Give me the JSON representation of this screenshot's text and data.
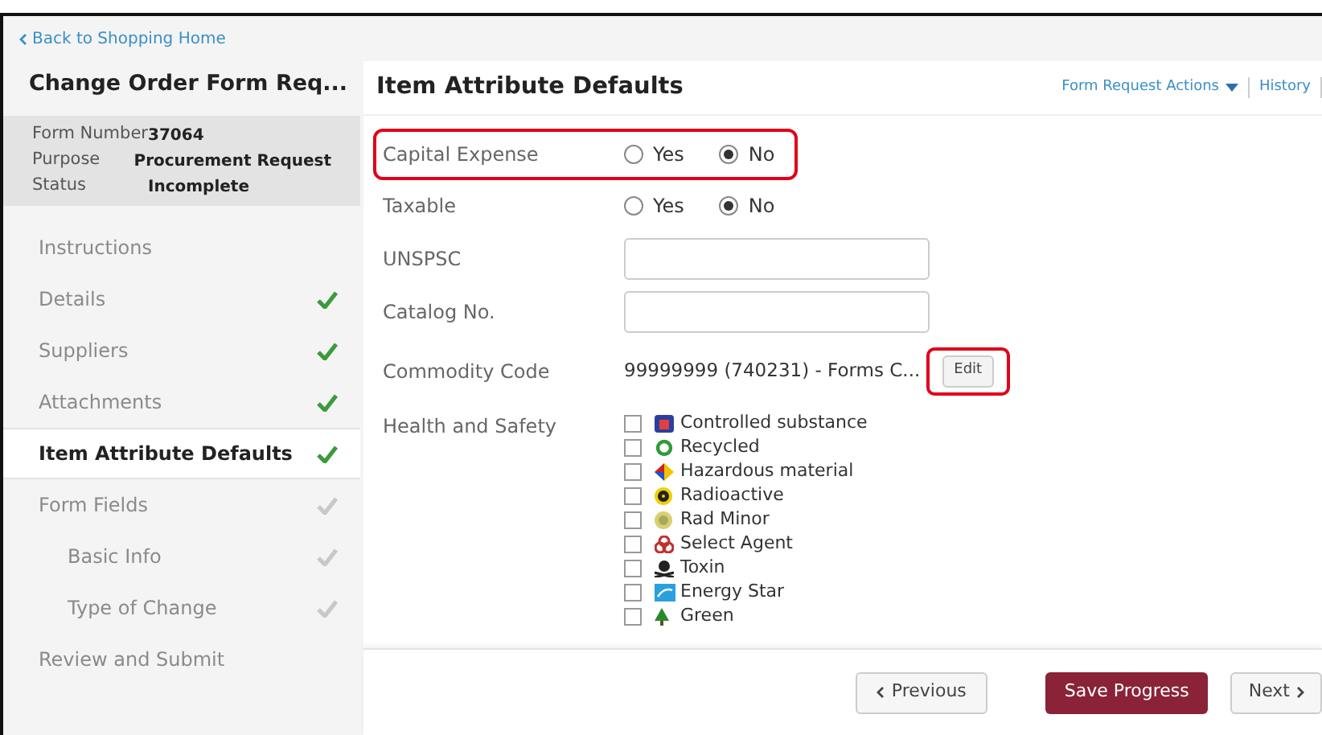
{
  "back_link": "Back to Shopping Home",
  "form_title": "Change Order Form Req...",
  "info": [
    {
      "label": "Form Number",
      "value": "37064"
    },
    {
      "label": "Purpose",
      "value": "Procurement Request"
    },
    {
      "label": "Status",
      "value": "Incomplete"
    }
  ],
  "nav": [
    {
      "label": "Instructions",
      "selected": false
    },
    {
      "label": "Details",
      "selected": false,
      "complete": true
    },
    {
      "label": "Suppliers",
      "selected": false,
      "complete": true
    },
    {
      "label": "Attachments",
      "selected": false,
      "complete": true
    },
    {
      "label": "Item Attribute Defaults",
      "selected": true,
      "complete": true
    },
    {
      "label": "Form Fields",
      "selected": false,
      "complete": false,
      "children": [
        {
          "label": "Basic Info",
          "selected": false,
          "complete": false
        },
        {
          "label": "Type of Change",
          "selected": false,
          "complete": false
        }
      ]
    },
    {
      "label": "Review and Submit",
      "selected": false
    }
  ],
  "page_title": "Item Attribute Defaults",
  "actions": [
    {
      "label": "Form Request Actions",
      "kind": "dropdown"
    },
    {
      "label": "History",
      "kind": "link"
    }
  ],
  "fields": [
    {
      "kind": "radio",
      "label": "Capital Expense",
      "highlighted": true,
      "options": [
        {
          "label": "Yes",
          "selected": false
        },
        {
          "label": "No",
          "selected": true
        }
      ]
    },
    {
      "kind": "radio",
      "label": "Taxable",
      "highlighted": false,
      "options": [
        {
          "label": "Yes",
          "selected": false
        },
        {
          "label": "No",
          "selected": true
        }
      ]
    },
    {
      "kind": "text",
      "label": "UNSPSC"
    },
    {
      "kind": "text",
      "label": "Catalog No."
    },
    {
      "kind": "code",
      "label": "Commodity Code",
      "value": "99999999 (740231) - Forms C...",
      "button": "Edit",
      "button_highlighted": true
    },
    {
      "kind": "checklist",
      "label": "Health and Safety",
      "items": [
        {
          "label": "Controlled substance",
          "checked": false
        },
        {
          "label": "Recycled",
          "checked": false
        },
        {
          "label": "Hazardous material",
          "checked": false
        },
        {
          "label": "Radioactive",
          "checked": false
        },
        {
          "label": "Rad Minor",
          "checked": false
        },
        {
          "label": "Select Agent",
          "checked": false
        },
        {
          "label": "Toxin",
          "checked": false
        },
        {
          "label": "Energy Star",
          "checked": false
        },
        {
          "label": "Green",
          "checked": false
        }
      ]
    }
  ],
  "footer": {
    "previous": "Previous",
    "save": "Save Progress",
    "next": "Next"
  }
}
